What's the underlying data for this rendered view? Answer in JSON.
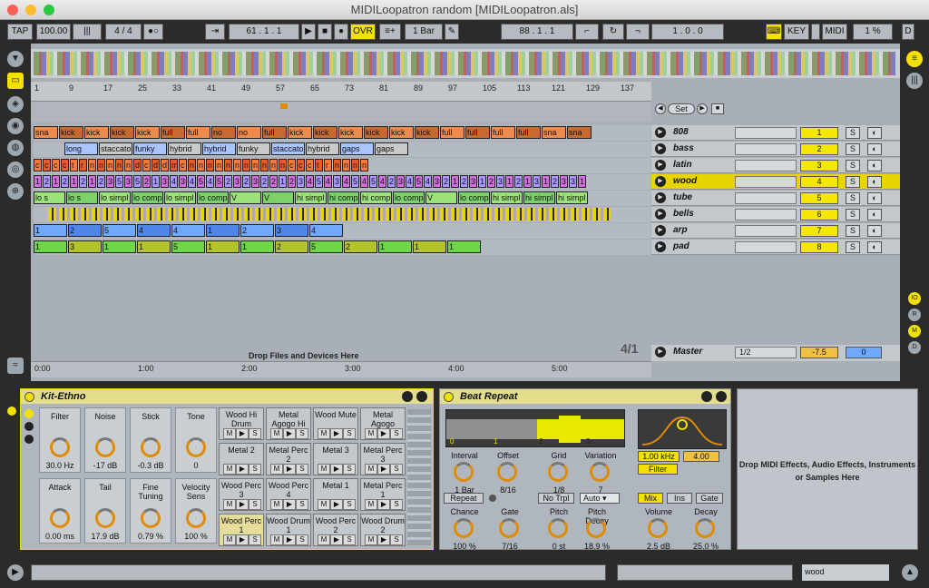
{
  "window": {
    "title": "MIDILoopatron random  [MIDILoopatron.als]"
  },
  "toolbar": {
    "tap": "TAP",
    "tempo": "100.00",
    "sig": "4 / 4",
    "position": "61 . 1 . 1",
    "ovr": "OVR",
    "quant": "1 Bar",
    "loop_start": "88 . 1 . 1",
    "loop_len": "1 . 0 . 0",
    "key": "KEY",
    "midi": "MIDI",
    "cpu": "1 %",
    "d": "D"
  },
  "arrangement": {
    "ruler": [
      "1",
      "9",
      "17",
      "25",
      "33",
      "41",
      "49",
      "57",
      "65",
      "73",
      "81",
      "89",
      "97",
      "105",
      "113",
      "121",
      "129",
      "137"
    ],
    "time": [
      "0:00",
      "1:00",
      "2:00",
      "3:00",
      "4:00",
      "5:00"
    ],
    "drop_text": "Drop Files and Devices Here",
    "set_label": "Set",
    "signature": "4/1"
  },
  "tracks": [
    {
      "name": "808",
      "num": "1"
    },
    {
      "name": "bass",
      "num": "2"
    },
    {
      "name": "latin",
      "num": "3"
    },
    {
      "name": "wood",
      "num": "4"
    },
    {
      "name": "tube",
      "num": "5"
    },
    {
      "name": "bells",
      "num": "6"
    },
    {
      "name": "arp",
      "num": "7"
    },
    {
      "name": "pad",
      "num": "8"
    }
  ],
  "master": {
    "name": "Master",
    "io": "1/2",
    "vol": "-7.5",
    "pan": "0"
  },
  "clips": {
    "808": [
      "sna",
      "kick",
      "kick",
      "kick",
      "kick",
      "full",
      "full",
      "no",
      "no",
      "full",
      "kick",
      "kick",
      "kick",
      "kick",
      "kick",
      "kick",
      "full",
      "full",
      "full",
      "full",
      "sna",
      "sna"
    ],
    "bass": [
      "long",
      "staccato",
      "funky",
      "hybrid",
      "hybrid",
      "funky",
      "staccato",
      "hybrid",
      "gaps",
      "gaps"
    ],
    "latin": [
      "c",
      "c",
      "c",
      "c",
      "t",
      "r",
      "n",
      "n",
      "n",
      "n",
      "n",
      "d",
      "c",
      "d",
      "d",
      "m",
      "c",
      "n",
      "n",
      "n",
      "n",
      "n",
      "n",
      "n",
      "n",
      "n",
      "n",
      "n",
      "c",
      "c",
      "c",
      "t",
      "r",
      "n",
      "n",
      "n",
      "n"
    ],
    "wood": [
      "1",
      "2",
      "1",
      "2",
      "1",
      "2",
      "1",
      "2",
      "3",
      "5",
      "3",
      "5",
      "2",
      "1",
      "3",
      "4",
      "3",
      "4",
      "5",
      "4",
      "5",
      "2",
      "3",
      "2",
      "3",
      "2",
      "2",
      "1",
      "2",
      "3",
      "4",
      "5",
      "4",
      "3",
      "4",
      "5",
      "4",
      "5",
      "4",
      "2",
      "3",
      "4",
      "5",
      "4",
      "3",
      "2",
      "1",
      "2",
      "3",
      "1",
      "2",
      "3",
      "1",
      "2",
      "1",
      "3",
      "1",
      "2",
      "3",
      "3",
      "1"
    ],
    "tube": [
      "lo s",
      "lo s",
      "lo simpl",
      "lo comp",
      "lo simpl",
      "lo comp",
      "V",
      "V",
      "hi simpl",
      "hi comp",
      "hi comp",
      "lo comp",
      "V",
      "lo comp",
      "hi simpl",
      "hi simpl",
      "hi simpl"
    ],
    "arp": [
      "1",
      "2",
      "5",
      "4",
      "4",
      "1",
      "2",
      "3",
      "4"
    ],
    "pad": [
      "1",
      "3",
      "1",
      "1",
      "5",
      "1",
      "1",
      "2",
      "5",
      "2",
      "1",
      "1",
      "1"
    ]
  },
  "kit": {
    "name": "Kit-Ethno",
    "params": [
      {
        "label": "Filter",
        "value": "30.0 Hz"
      },
      {
        "label": "Noise",
        "value": "-17 dB"
      },
      {
        "label": "Stick",
        "value": "-0.3 dB"
      },
      {
        "label": "Tone",
        "value": "0"
      },
      {
        "label": "Attack",
        "value": "0.00 ms"
      },
      {
        "label": "Tail",
        "value": "17.9 dB"
      },
      {
        "label": "Fine Tuning",
        "value": "0.79 %"
      },
      {
        "label": "Velocity Sens",
        "value": "100 %"
      }
    ],
    "pads": [
      "Wood Hi Drum",
      "Metal Agogo Hi",
      "Wood Mute",
      "Metal Agogo",
      "Metal 2",
      "Metal Perc 2",
      "Metal 3",
      "Metal Perc 3",
      "Wood Perc 3",
      "Wood Perc 4",
      "Metal 1",
      "Metal Perc 1",
      "Wood Perc 1",
      "Wood Drum 1",
      "Wood Perc 2",
      "Wood Drum 2"
    ],
    "pad_btns": {
      "m": "M",
      "p": "▶",
      "s": "S"
    }
  },
  "beat": {
    "name": "Beat Repeat",
    "labels": {
      "interval": "Interval",
      "offset": "Offset",
      "grid": "Grid",
      "variation": "Variation",
      "chance": "Chance",
      "gate": "Gate",
      "pitch": "Pitch",
      "pitch_decay": "Pitch Decay",
      "volume": "Volume",
      "decay": "Decay"
    },
    "values": {
      "interval": "1 Bar",
      "offset": "8/16",
      "grid": "1/8",
      "variation": "7",
      "chance": "100 %",
      "gate": "7/16",
      "pitch": "0 st",
      "pitch_decay": "18.9 %",
      "volume": "2.5 dB",
      "decay": "25.0 %"
    },
    "buttons": {
      "repeat": "Repeat",
      "no_trpl": "No Trpl",
      "auto": "Auto",
      "mix": "Mix",
      "ins": "Ins",
      "gate": "Gate",
      "filter": "Filter"
    },
    "freq": "1.00 kHz",
    "width": "4.00",
    "bar_ticks": [
      "0",
      "1",
      "2",
      "3"
    ]
  },
  "drop_midi": "Drop MIDI Effects, Audio Effects, Instruments or Samples Here",
  "status": {
    "track": "wood"
  },
  "colors": {
    "accent": "#f3e100",
    "clip_orange": "#f08a4b",
    "clip_purple": "#d56ce0",
    "clip_green": "#6fd64a"
  }
}
